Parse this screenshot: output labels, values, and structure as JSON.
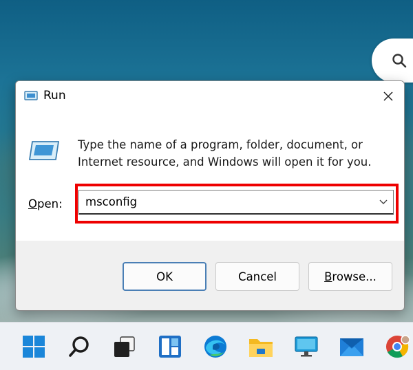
{
  "dialog": {
    "title": "Run",
    "description": "Type the name of a program, folder, document, or Internet resource, and Windows will open it for you.",
    "open_label_access_key": "O",
    "open_label_rest": "pen:",
    "command_value": "msconfig",
    "buttons": {
      "ok": "OK",
      "cancel": "Cancel",
      "browse_access_key": "B",
      "browse_rest": "rowse..."
    }
  },
  "taskbar": {
    "icons": [
      "windows-start-icon",
      "search-icon",
      "task-view-icon",
      "widgets-icon",
      "edge-browser-icon",
      "file-explorer-icon",
      "remote-desktop-icon",
      "mail-icon",
      "chrome-browser-icon"
    ]
  },
  "colors": {
    "highlight": "#ee0000",
    "ok_button_border": "#4a7fb5",
    "taskbar": "#eef1f5"
  }
}
